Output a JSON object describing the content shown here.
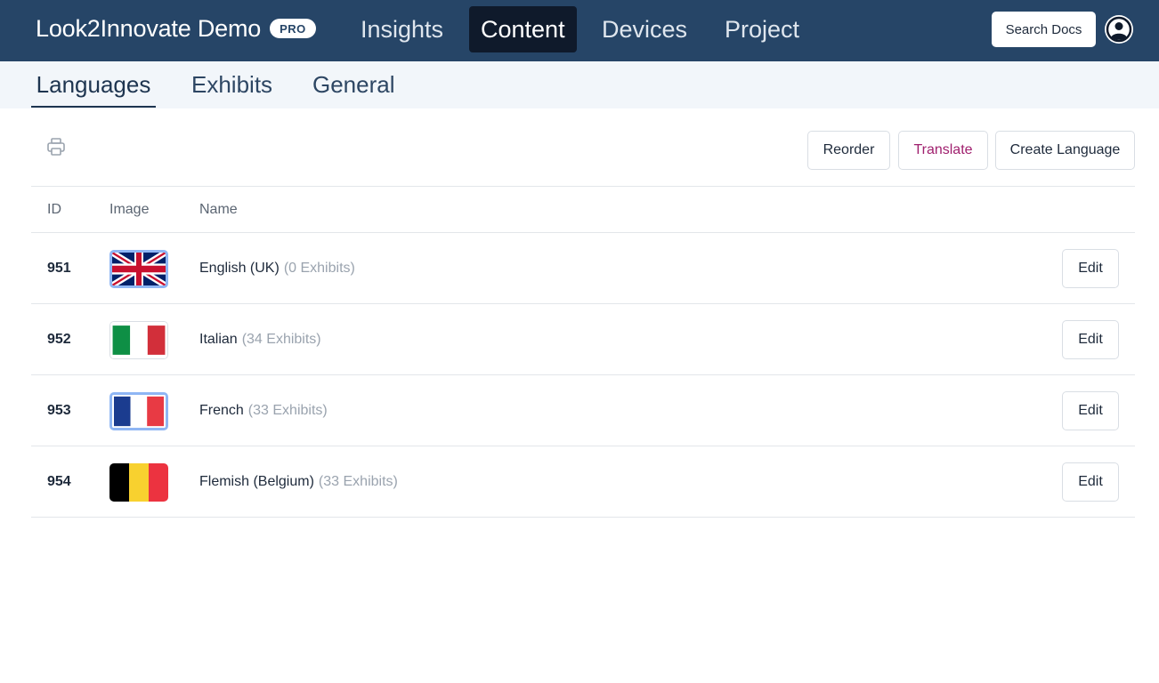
{
  "header": {
    "brand": "Look2Innovate Demo",
    "badge": "PRO",
    "nav": [
      {
        "label": "Insights",
        "active": false
      },
      {
        "label": "Content",
        "active": true
      },
      {
        "label": "Devices",
        "active": false
      },
      {
        "label": "Project",
        "active": false
      }
    ],
    "search_docs": "Search Docs",
    "avatar_icon": "user-circle-icon"
  },
  "subnav": {
    "tabs": [
      {
        "label": "Languages",
        "active": true
      },
      {
        "label": "Exhibits",
        "active": false
      },
      {
        "label": "General",
        "active": false
      }
    ]
  },
  "toolbar": {
    "print_icon": "printer-icon",
    "reorder": "Reorder",
    "translate": "Translate",
    "create": "Create Language"
  },
  "table": {
    "headers": {
      "id": "ID",
      "image": "Image",
      "name": "Name"
    },
    "rows": [
      {
        "id": "951",
        "flag": "uk",
        "name": "English (UK)",
        "count": "(0 Exhibits)",
        "selected": true,
        "edit": "Edit"
      },
      {
        "id": "952",
        "flag": "italy",
        "name": "Italian",
        "count": "(34 Exhibits)",
        "selected": false,
        "edit": "Edit"
      },
      {
        "id": "953",
        "flag": "france",
        "name": "French",
        "count": "(33 Exhibits)",
        "selected": true,
        "edit": "Edit"
      },
      {
        "id": "954",
        "flag": "belgium",
        "name": "Flemish (Belgium)",
        "count": "(33 Exhibits)",
        "selected": false,
        "edit": "Edit"
      }
    ]
  },
  "colors": {
    "header_bg": "#264567",
    "active_nav_bg": "#0f1a2b",
    "subnav_bg": "#f2f6fa",
    "translate_text": "#a0206e",
    "selection_outline": "#8fb6f4"
  }
}
